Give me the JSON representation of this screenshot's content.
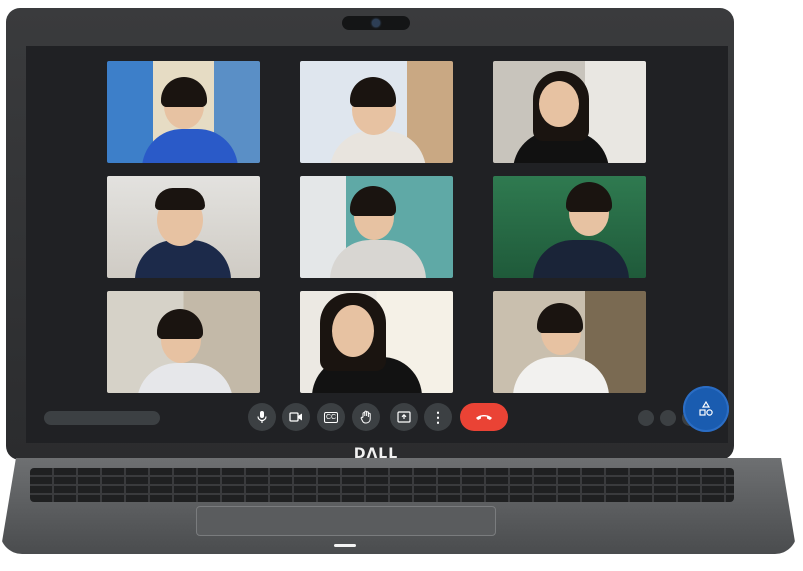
{
  "brand": {
    "logo_text": "DɅLL"
  },
  "meeting": {
    "participants": [
      {
        "name": "participant-1"
      },
      {
        "name": "participant-2"
      },
      {
        "name": "participant-3"
      },
      {
        "name": "participant-4"
      },
      {
        "name": "participant-5"
      },
      {
        "name": "participant-6"
      },
      {
        "name": "participant-7"
      },
      {
        "name": "participant-8"
      },
      {
        "name": "participant-9"
      }
    ],
    "controls": {
      "mic_icon": "microphone-icon",
      "camera_icon": "video-camera-icon",
      "captions_label": "CC",
      "raise_hand_icon": "raise-hand-icon",
      "present_icon": "present-screen-icon",
      "more_label": "⋮",
      "end_call_icon": "phone-hangup-icon"
    },
    "activities_icon": "activities-icon"
  },
  "colors": {
    "screen_bg": "#202124",
    "control_bg": "#3c4043",
    "end_call": "#ea4335",
    "activity_button": "#1a5cb0"
  }
}
